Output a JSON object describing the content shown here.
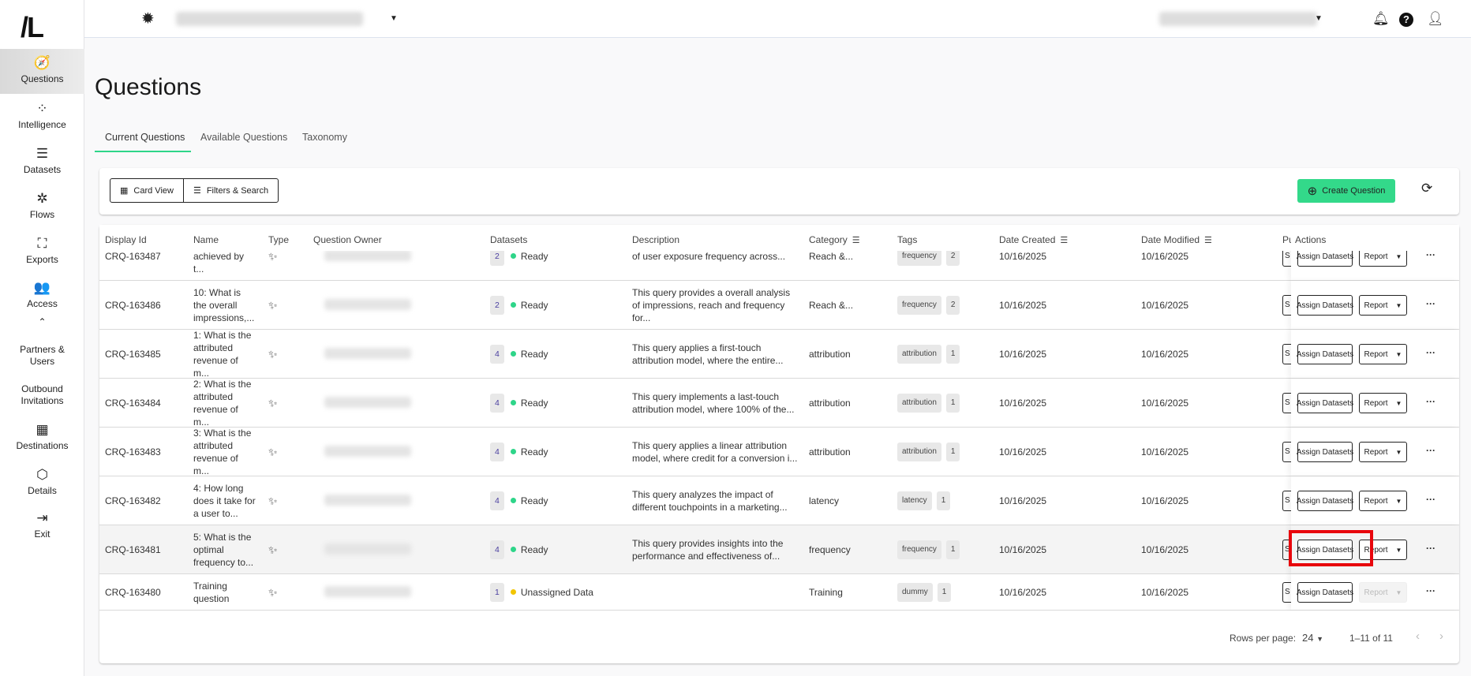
{
  "logo": "/L",
  "sidebar": {
    "items": [
      {
        "label": "Questions",
        "icon": "compass-icon",
        "glyph": "🧭",
        "active": true
      },
      {
        "label": "Intelligence",
        "icon": "bubbles-icon",
        "glyph": "⁘"
      },
      {
        "label": "Datasets",
        "icon": "database-icon",
        "glyph": "☰"
      },
      {
        "label": "Flows",
        "icon": "flows-icon",
        "glyph": "✲"
      },
      {
        "label": "Exports",
        "icon": "expand-icon",
        "glyph": "⛶"
      },
      {
        "label": "Access",
        "icon": "people-icon",
        "glyph": "👥"
      },
      {
        "label": "Partners & Users",
        "icon": "",
        "glyph": ""
      },
      {
        "label": "Outbound Invitations",
        "icon": "",
        "glyph": ""
      },
      {
        "label": "Destinations",
        "icon": "grid-icon",
        "glyph": "▦"
      },
      {
        "label": "Details",
        "icon": "cube-icon",
        "glyph": "⬡"
      },
      {
        "label": "Exit",
        "icon": "exit-icon",
        "glyph": "⇥"
      }
    ],
    "collapse_glyph": "⌃"
  },
  "page": {
    "title": "Questions"
  },
  "tabs": [
    {
      "label": "Current Questions",
      "active": true
    },
    {
      "label": "Available Questions"
    },
    {
      "label": "Taxonomy"
    }
  ],
  "toolbar": {
    "card_view": "Card View",
    "filters": "Filters & Search",
    "create": "Create Question",
    "accent": "#33d98a"
  },
  "table": {
    "headers": {
      "id": "Display Id",
      "name": "Name",
      "type": "Type",
      "owner": "Question Owner",
      "datasets": "Datasets",
      "description": "Description",
      "category": "Category",
      "tags": "Tags",
      "created": "Date Created",
      "modified": "Date Modified",
      "pu": "Pu",
      "actions": "Actions"
    },
    "action_labels": {
      "s": "S",
      "assign": "Assign Datasets",
      "report": "Report",
      "more": "···"
    },
    "rows": [
      {
        "id": "CRQ-163487",
        "name": "unique reach achieved by t...",
        "datasets": "2",
        "status": "Ready",
        "status_color": "#2ed589",
        "description": "of user exposure frequency across...",
        "category": "Reach &...",
        "tag": "frequency",
        "tag_count": "2",
        "created": "10/16/2025",
        "modified": "10/16/2025",
        "report_enabled": true
      },
      {
        "id": "CRQ-163486",
        "name": "10: What is the overall impressions,...",
        "datasets": "2",
        "status": "Ready",
        "status_color": "#2ed589",
        "description": "This query provides a overall analysis of impressions, reach and frequency for...",
        "category": "Reach &...",
        "tag": "frequency",
        "tag_count": "2",
        "created": "10/16/2025",
        "modified": "10/16/2025",
        "report_enabled": true
      },
      {
        "id": "CRQ-163485",
        "name": "1: What is the attributed revenue of m...",
        "datasets": "4",
        "status": "Ready",
        "status_color": "#2ed589",
        "description": "This query applies a first-touch attribution model, where the entire...",
        "category": "attribution",
        "tag": "attribution",
        "tag_count": "1",
        "created": "10/16/2025",
        "modified": "10/16/2025",
        "report_enabled": true
      },
      {
        "id": "CRQ-163484",
        "name": "2: What is the attributed revenue of m...",
        "datasets": "4",
        "status": "Ready",
        "status_color": "#2ed589",
        "description": "This query implements a last-touch attribution model, where 100% of the...",
        "category": "attribution",
        "tag": "attribution",
        "tag_count": "1",
        "created": "10/16/2025",
        "modified": "10/16/2025",
        "report_enabled": true
      },
      {
        "id": "CRQ-163483",
        "name": "3: What is the attributed revenue of m...",
        "datasets": "4",
        "status": "Ready",
        "status_color": "#2ed589",
        "description": "This query applies a linear attribution model, where credit for a conversion i...",
        "category": "attribution",
        "tag": "attribution",
        "tag_count": "1",
        "created": "10/16/2025",
        "modified": "10/16/2025",
        "report_enabled": true
      },
      {
        "id": "CRQ-163482",
        "name": "4: How long does it take for a user to...",
        "datasets": "4",
        "status": "Ready",
        "status_color": "#2ed589",
        "description": "This query analyzes the impact of different touchpoints in a marketing...",
        "category": "latency",
        "tag": "latency",
        "tag_count": "1",
        "created": "10/16/2025",
        "modified": "10/16/2025",
        "report_enabled": true
      },
      {
        "id": "CRQ-163481",
        "name": "5: What is the optimal frequency to...",
        "datasets": "4",
        "status": "Ready",
        "status_color": "#2ed589",
        "description": "This query provides insights into the performance and effectiveness of...",
        "category": "frequency",
        "tag": "frequency",
        "tag_count": "1",
        "created": "10/16/2025",
        "modified": "10/16/2025",
        "report_enabled": true,
        "highlighted": true
      },
      {
        "id": "CRQ-163480",
        "name": "Training question",
        "datasets": "1",
        "status": "Unassigned Data",
        "status_color": "#f2c500",
        "description": "",
        "category": "Training",
        "tag": "dummy",
        "tag_count": "1",
        "created": "10/16/2025",
        "modified": "10/16/2025",
        "report_enabled": false
      }
    ]
  },
  "pagination": {
    "rows_per_page_label": "Rows per page:",
    "rows_per_page": "24",
    "range": "1–11 of 11"
  }
}
